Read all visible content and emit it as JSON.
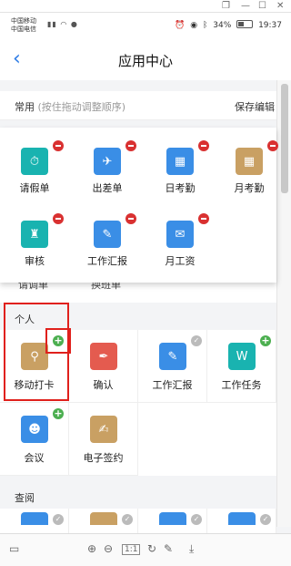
{
  "window": {
    "restore": "❐",
    "minimize": "—",
    "maximize": "☐",
    "close": "✕"
  },
  "status": {
    "carrier1": "中国移动",
    "carrier2": "中国电信",
    "battery": "34%",
    "time": "19:37"
  },
  "header": {
    "back": "‹",
    "title": "应用中心"
  },
  "edit": {
    "label": "常用",
    "hint": "(按住拖动调整顺序)",
    "save": "保存编辑"
  },
  "common": [
    {
      "label": "请假单",
      "color": "#19b3b0",
      "icon": "person-clock-icon"
    },
    {
      "label": "出差单",
      "color": "#3a8ee6",
      "icon": "airplane-icon"
    },
    {
      "label": "日考勤",
      "color": "#3a8ee6",
      "icon": "calendar-icon"
    },
    {
      "label": "月考勤",
      "color": "#c9a063",
      "icon": "calendar-icon"
    },
    {
      "label": "审核",
      "color": "#19b3b0",
      "icon": "stamp-icon"
    },
    {
      "label": "工作汇报",
      "color": "#3a8ee6",
      "icon": "edit-doc-icon"
    },
    {
      "label": "月工资",
      "color": "#3a8ee6",
      "icon": "envelope-icon"
    }
  ],
  "behind": {
    "a": "请调单",
    "b": "换班单"
  },
  "personal": {
    "title": "个人",
    "items": [
      {
        "label": "移动打卡",
        "color": "#c9a063",
        "icon": "location-pin-icon"
      },
      {
        "label": "确认",
        "color": "#e45b4f",
        "icon": "pen-icon"
      },
      {
        "label": "工作汇报",
        "color": "#3a8ee6",
        "icon": "edit-doc-icon"
      },
      {
        "label": "工作任务",
        "color": "#19b3b0",
        "icon": "task-icon"
      },
      {
        "label": "会议",
        "color": "#3a8ee6",
        "icon": "meeting-icon"
      },
      {
        "label": "电子签约",
        "color": "#c9a063",
        "icon": "contract-icon"
      }
    ]
  },
  "query": {
    "title": "查阅"
  }
}
